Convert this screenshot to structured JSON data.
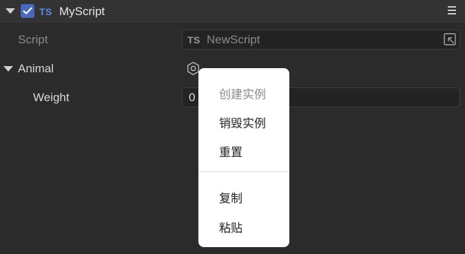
{
  "component": {
    "tag": "TS",
    "name": "MyScript",
    "enabled": true
  },
  "script_row": {
    "label": "Script",
    "tag": "TS",
    "value": "NewScript"
  },
  "animal_section": {
    "label": "Animal",
    "weight_label": "Weight",
    "weight_value": "0"
  },
  "context_menu": {
    "items": [
      {
        "label": "创建实例",
        "enabled": false
      },
      {
        "label": "销毁实例",
        "enabled": true
      },
      {
        "label": "重置",
        "enabled": true
      },
      {
        "label": "复制",
        "enabled": true
      },
      {
        "label": "粘贴",
        "enabled": true
      }
    ]
  },
  "colors": {
    "background": "#2b2b2b",
    "header": "#333333",
    "accent_checkbox": "#4a69bd",
    "ts_tag": "#5b8de6",
    "popup": "#ffffff"
  },
  "icons": [
    "collapse-triangle-icon",
    "checkbox-checked-icon",
    "menu-icon",
    "locate-asset-icon",
    "settings-hexagon-icon"
  ]
}
